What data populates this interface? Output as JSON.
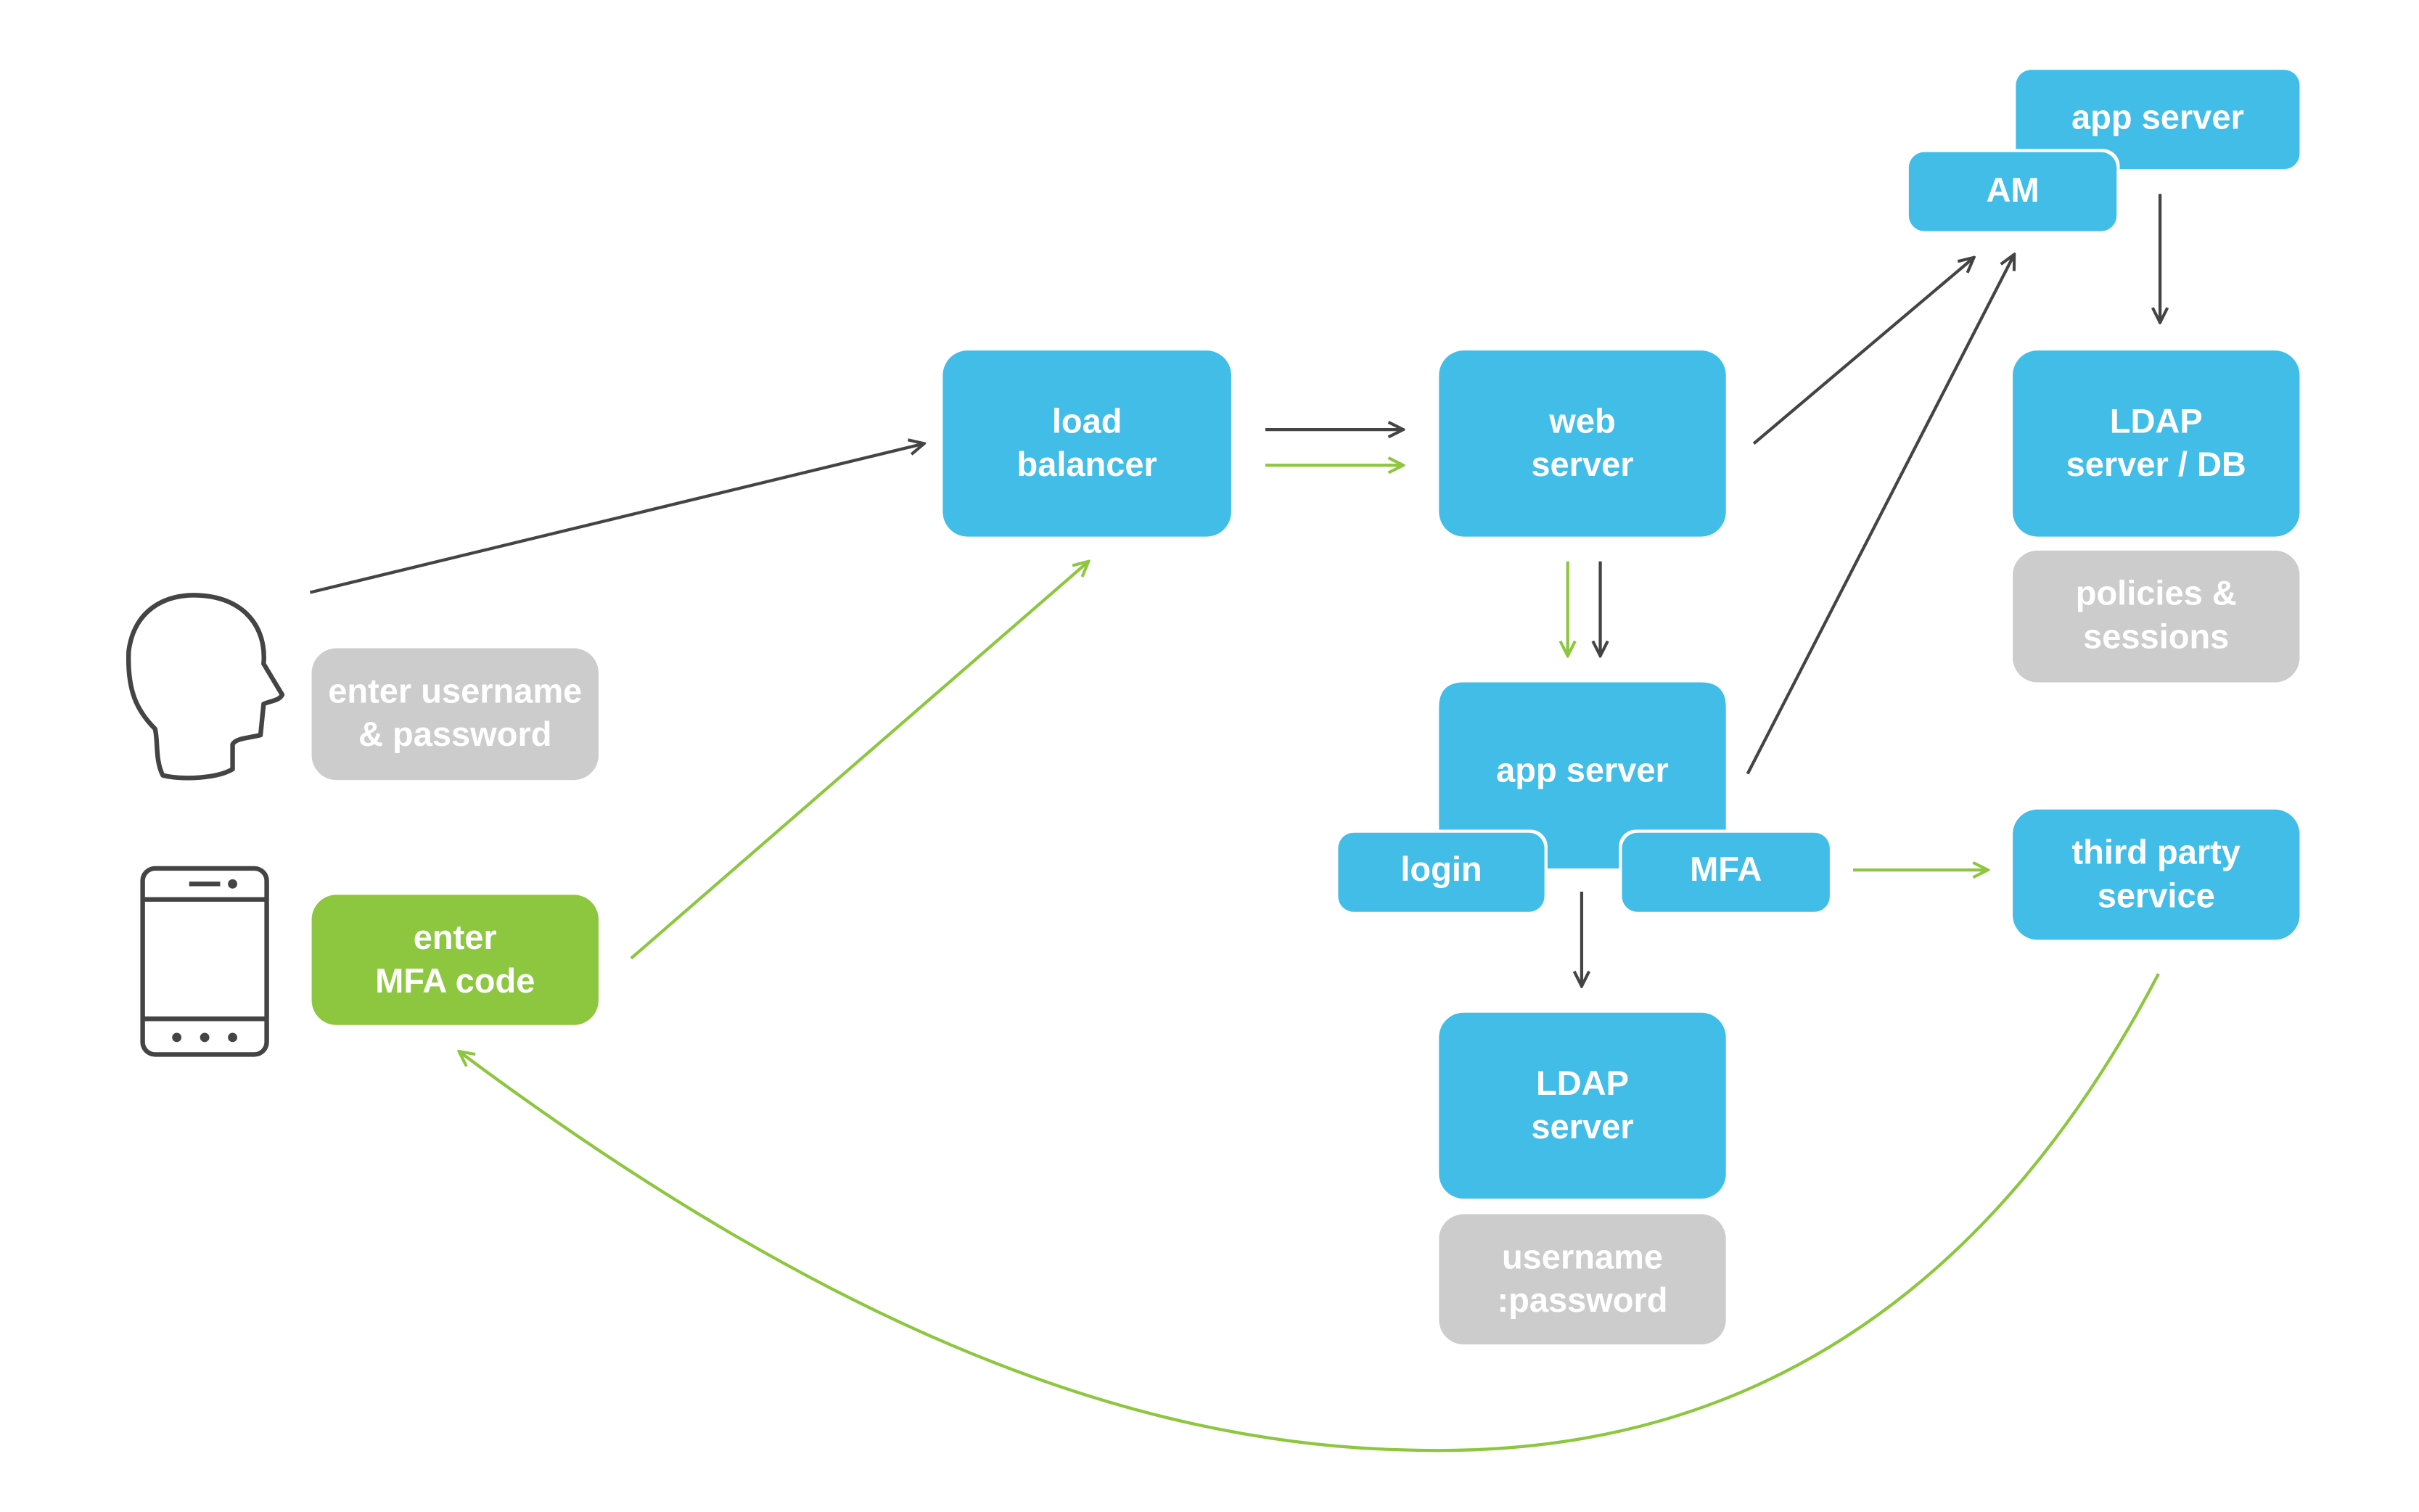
{
  "colors": {
    "node_blue": "#41bde8",
    "mfa_green": "#8dc63f",
    "note_gray": "#cccccc",
    "arrow_dark": "#444444"
  },
  "icons": {
    "user": "user-head-icon",
    "phone": "smartphone-icon"
  },
  "nodes": {
    "load_balancer": [
      "load",
      "balancer"
    ],
    "web_server": [
      "web",
      "server"
    ],
    "app_server_top": "app server",
    "am": "AM",
    "ldap_db": [
      "LDAP",
      "server / DB"
    ],
    "policies": [
      "policies &",
      "sessions"
    ],
    "app_server_mid": "app server",
    "login": "login",
    "mfa": "MFA",
    "third_party": [
      "third party",
      "service"
    ],
    "ldap_server": [
      "LDAP",
      "server"
    ],
    "credentials": [
      "username",
      ":password"
    ],
    "enter_credentials": [
      "enter username",
      "& password"
    ],
    "enter_mfa": [
      "enter",
      "MFA code"
    ]
  }
}
